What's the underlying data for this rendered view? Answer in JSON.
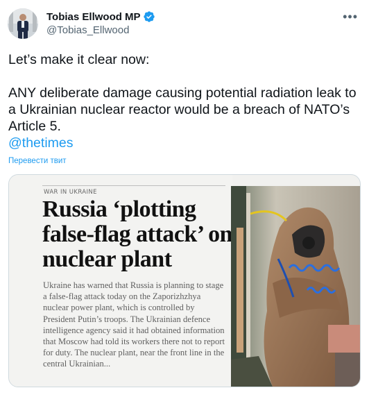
{
  "author": {
    "name": "Tobias Ellwood MP",
    "handle": "@Tobias_Ellwood",
    "verified_icon": "verified-badge-icon"
  },
  "tweet": {
    "line1": "Let’s make it clear now:",
    "line2": "ANY deliberate damage causing potential radiation leak to a Ukrainian nuclear reactor would be a breach of NATO’s Article 5.",
    "mention": "@thetimes",
    "translate_link": "Перевести твит"
  },
  "card": {
    "kicker": "WAR IN UKRAINE",
    "headline": "Russia ‘plotting false-flag attack’ on nuclear plant",
    "body": "Ukraine has warned that Russia is planning to stage a false-flag attack today on the Zaporizhzhya nuclear power plant, which is controlled by President Putin’s troops. The Ukrainian defence intelligence agency said it had obtained information that Moscow had told its workers there not to report for duty. The nuclear plant, near the front line in the central Ukrainian..."
  },
  "colors": {
    "accent": "#1d9bf0",
    "text": "#0f1419",
    "muted": "#536471"
  }
}
